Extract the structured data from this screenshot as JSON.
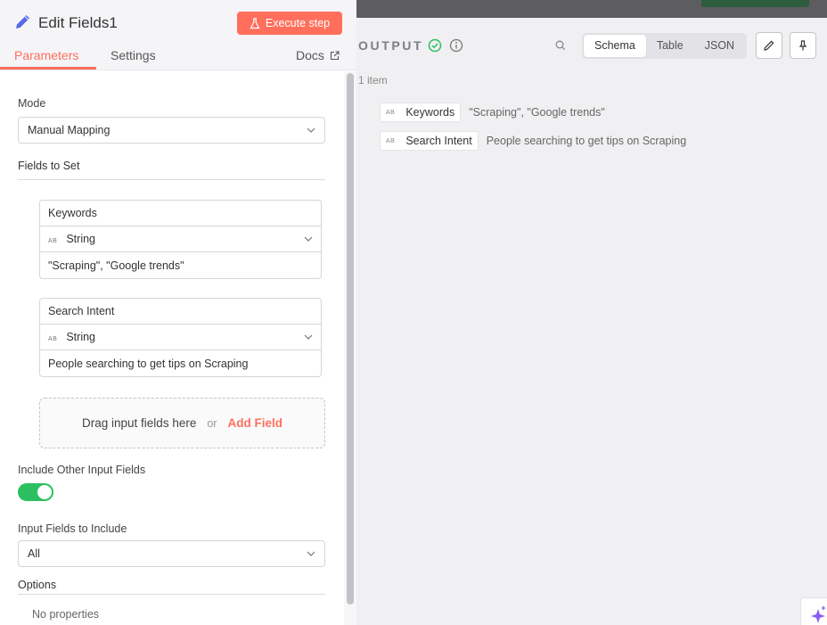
{
  "output": {
    "title": "OUTPUT",
    "item_count": "1 item",
    "view_tabs": [
      {
        "label": "Schema",
        "active": true
      },
      {
        "label": "Table",
        "active": false
      },
      {
        "label": "JSON",
        "active": false
      }
    ],
    "schema": [
      {
        "type_icon": "AB",
        "name": "Keywords",
        "value": "\"Scraping\", \"Google trends\""
      },
      {
        "type_icon": "AB",
        "name": "Search Intent",
        "value": "People searching to get tips on Scraping"
      }
    ]
  },
  "panel": {
    "title": "Edit Fields1",
    "execute_label": "Execute step",
    "tabs": {
      "parameters": "Parameters",
      "settings": "Settings",
      "docs": "Docs"
    },
    "mode": {
      "label": "Mode",
      "value": "Manual Mapping"
    },
    "fields_to_set_label": "Fields to Set",
    "fields": [
      {
        "name": "Keywords",
        "type_icon": "AB",
        "type": "String",
        "value": "\"Scraping\", \"Google trends\""
      },
      {
        "name": "Search Intent",
        "type_icon": "AB",
        "type": "String",
        "value": "People searching to get tips on Scraping"
      }
    ],
    "drop_zone": {
      "text": "Drag input fields here",
      "or": "or",
      "add_field": "Add Field"
    },
    "include_other": {
      "label": "Include Other Input Fields",
      "enabled": true
    },
    "input_fields_include": {
      "label": "Input Fields to Include",
      "value": "All"
    },
    "options": {
      "label": "Options",
      "empty_text": "No properties"
    }
  },
  "colors": {
    "accent": "#ff6f5c",
    "toggle_on": "#2cbf61",
    "success": "#2cbf61"
  }
}
